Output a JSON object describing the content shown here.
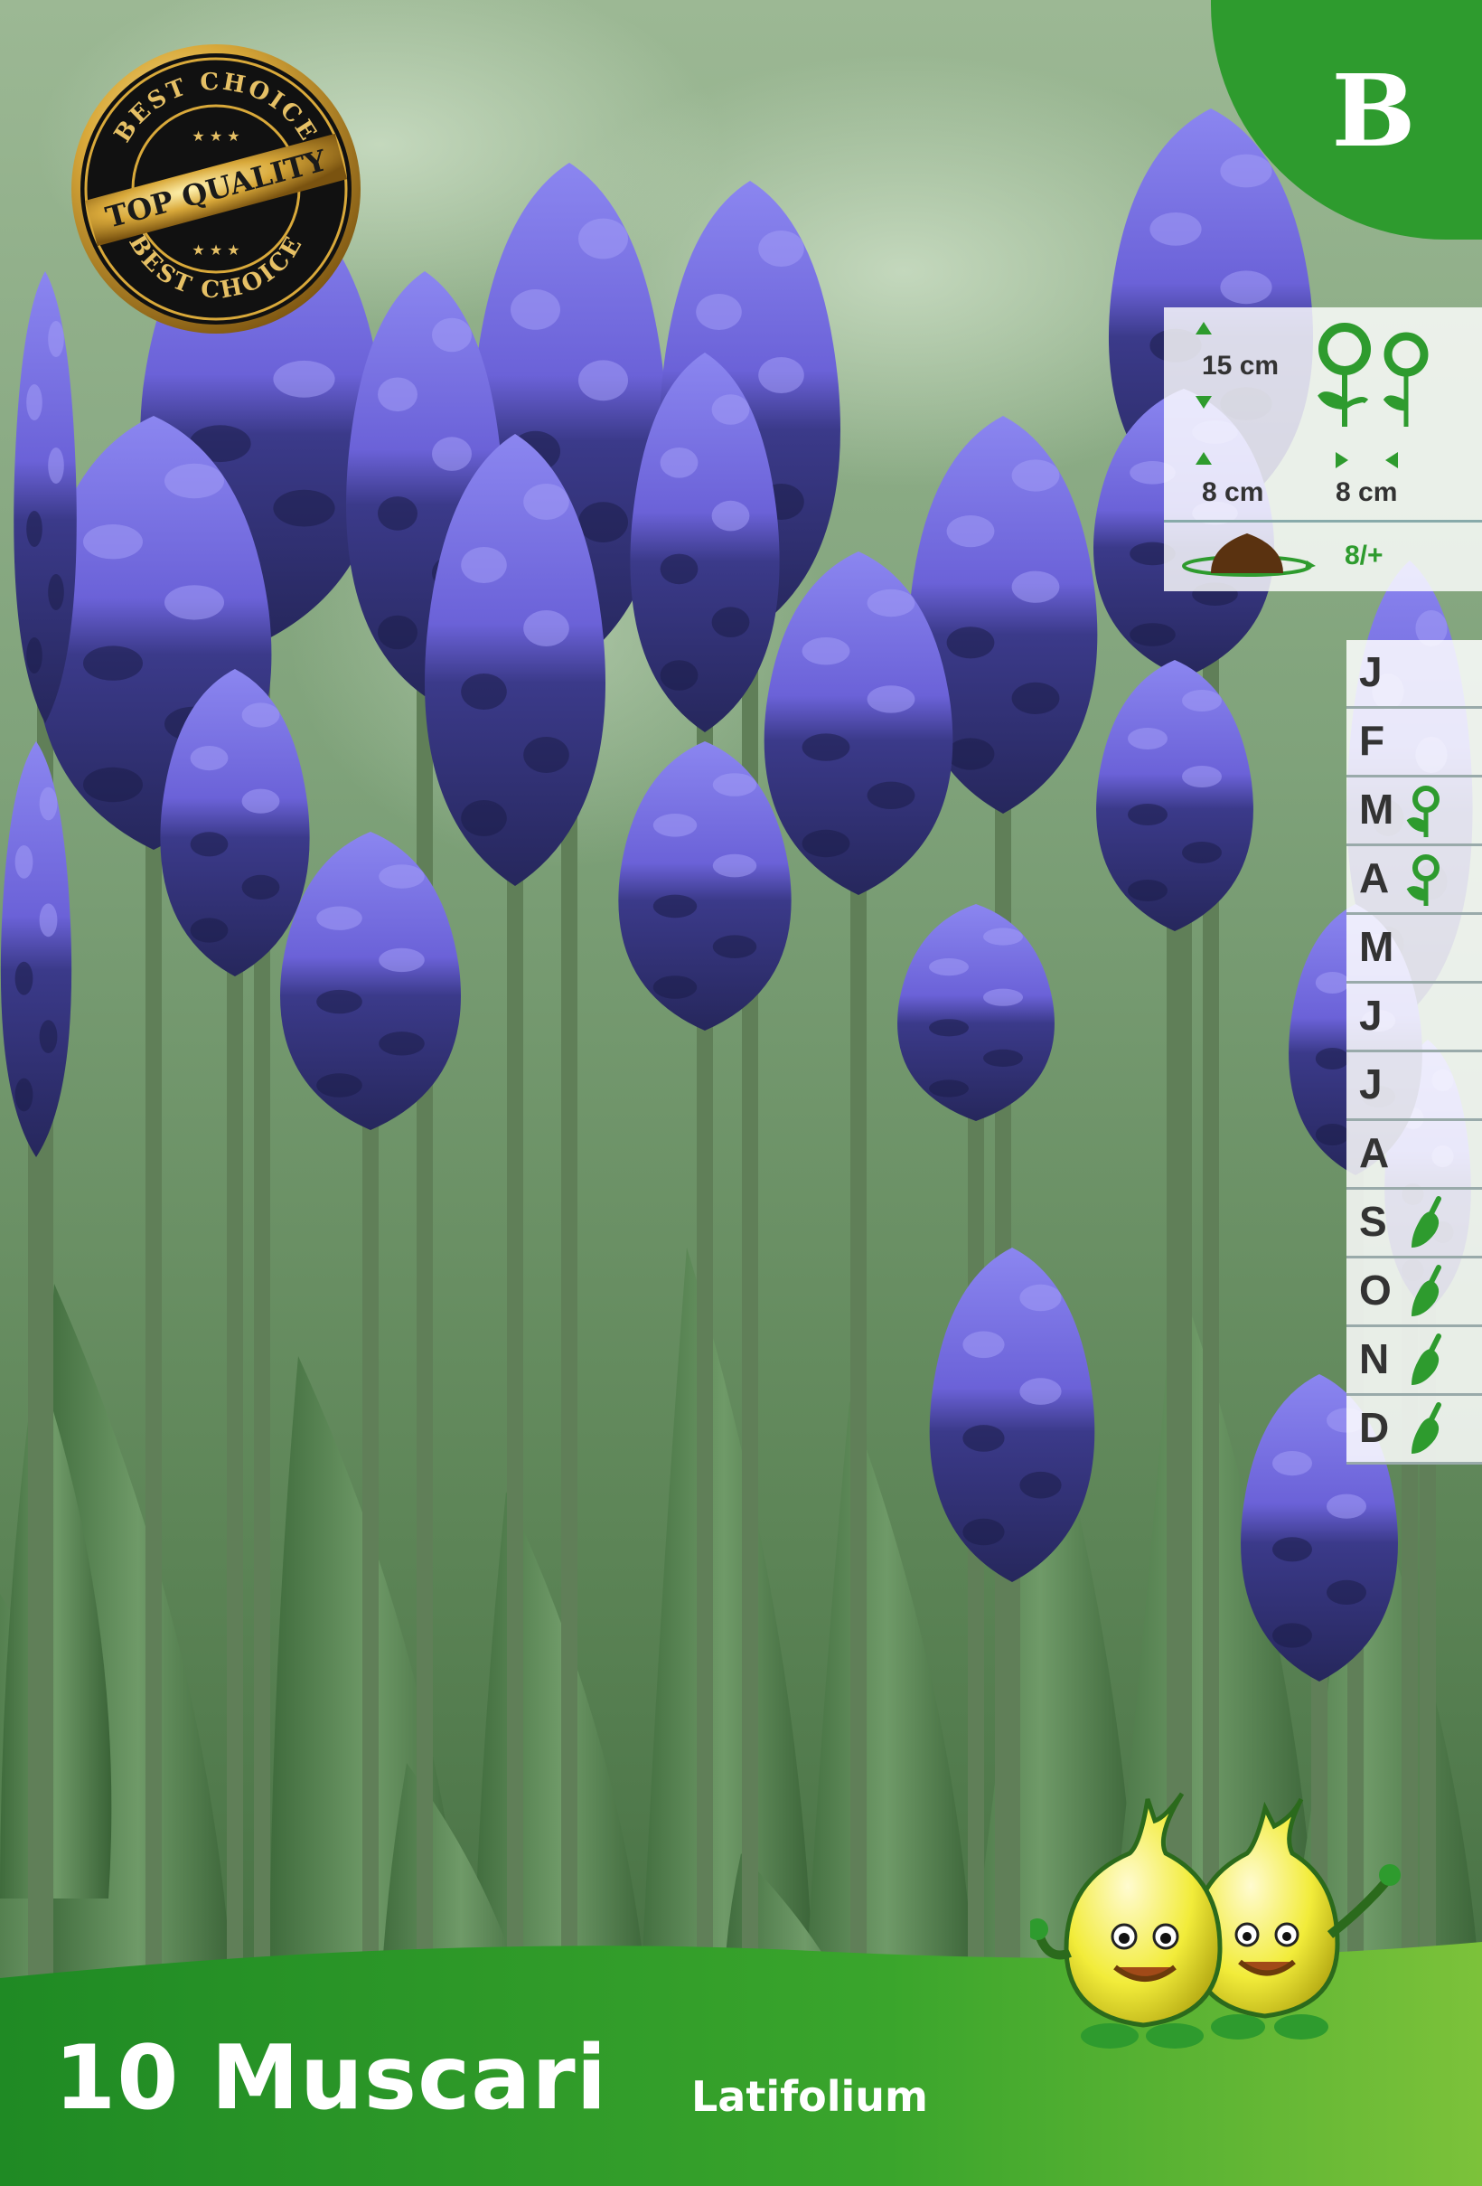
{
  "badge": {
    "letter": "B"
  },
  "seal": {
    "top_text": "BEST CHOICE",
    "middle_text": "TOP QUALITY",
    "bottom_text": "BEST CHOICE"
  },
  "planting_info": {
    "height_label": "15 cm",
    "depth_label": "8 cm",
    "spacing_label": "8 cm",
    "hardiness_label": "8/+"
  },
  "calendar": {
    "months": [
      {
        "letter": "J",
        "icon": "none"
      },
      {
        "letter": "F",
        "icon": "none"
      },
      {
        "letter": "M",
        "icon": "flower-icon"
      },
      {
        "letter": "A",
        "icon": "flower-icon"
      },
      {
        "letter": "M",
        "icon": "none"
      },
      {
        "letter": "J",
        "icon": "none"
      },
      {
        "letter": "J",
        "icon": "none"
      },
      {
        "letter": "A",
        "icon": "none"
      },
      {
        "letter": "S",
        "icon": "trowel-icon"
      },
      {
        "letter": "O",
        "icon": "trowel-icon"
      },
      {
        "letter": "N",
        "icon": "trowel-icon"
      },
      {
        "letter": "D",
        "icon": "trowel-icon"
      }
    ]
  },
  "product": {
    "title": "10 Muscari",
    "subtitle": "Latifolium"
  },
  "colors": {
    "brand_green": "#2e9b2e",
    "flower_light": "#7b7be8",
    "flower_dark": "#2c2d6a",
    "leaf": "#4f7d4a"
  }
}
